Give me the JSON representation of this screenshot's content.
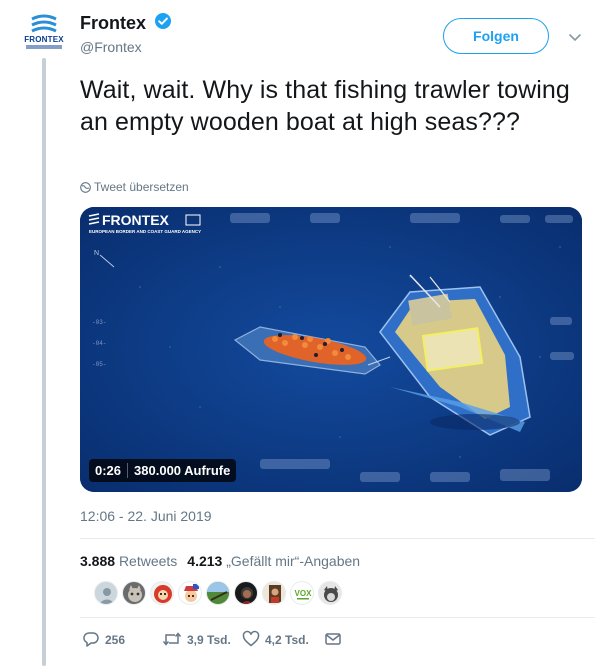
{
  "account": {
    "display_name": "Frontex",
    "handle": "@Frontex",
    "verified": true,
    "logo_text": "FRONTEX"
  },
  "header": {
    "follow_label": "Folgen",
    "more_icon": "chevron-down-icon"
  },
  "tweet": {
    "text": "Wait, wait. Why is that fishing trawler towing an empty wooden boat at high seas???",
    "translate_label": "Tweet übersetzen",
    "timestamp": "12:06 - 22. Juni 2019"
  },
  "media": {
    "watermark_title": "FRONTEX",
    "watermark_subtitle": "EUROPEAN BORDER AND COAST GUARD AGENCY",
    "hud_marks": [
      "-03-",
      "-04-",
      "-05-"
    ],
    "compass_label": "N",
    "duration": "0:26",
    "views": "380.000 Aufrufe"
  },
  "stats": {
    "retweets_count": "3.888",
    "retweets_label": "Retweets",
    "likes_count": "4.213",
    "likes_label": "„Gefällt mir“-Angaben"
  },
  "liker_avatars": [
    "avatar-default",
    "avatar-cat",
    "avatar-cartoon",
    "avatar-flag",
    "avatar-field",
    "avatar-face",
    "avatar-portrait",
    "avatar-vox",
    "avatar-dog"
  ],
  "liker_vox_text": "VOX",
  "actions": {
    "reply_count": "256",
    "retweet_count": "3,9 Tsd.",
    "like_count": "4,2 Tsd."
  },
  "colors": {
    "brand_blue": "#1da1f2",
    "text_primary": "#14171a",
    "text_secondary": "#657786",
    "thread_line": "#c4cfd6",
    "sea_blue": "#0c3a86"
  }
}
